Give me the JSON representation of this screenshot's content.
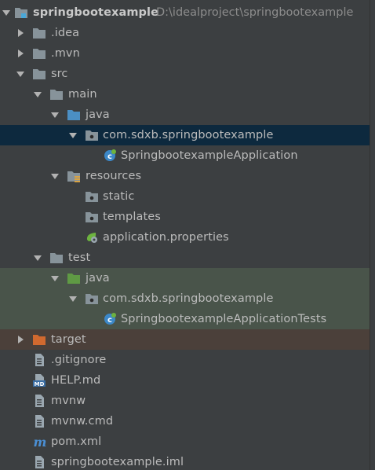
{
  "project_tree": {
    "root": {
      "name": "springbootexample",
      "path": "D:\\idealproject\\springbootexample"
    },
    "nodes": [
      {
        "label": ".idea",
        "icon": "folder-icon"
      },
      {
        "label": ".mvn",
        "icon": "folder-icon"
      },
      {
        "label": "src",
        "icon": "folder-icon"
      },
      {
        "label": "main",
        "icon": "folder-icon"
      },
      {
        "label": "java",
        "icon": "source-root-folder-icon"
      },
      {
        "label": "com.sdxb.springbootexample",
        "icon": "package-icon"
      },
      {
        "label": "SpringbootexampleApplication",
        "icon": "spring-boot-class-icon"
      },
      {
        "label": "resources",
        "icon": "resources-folder-icon"
      },
      {
        "label": "static",
        "icon": "package-icon"
      },
      {
        "label": "templates",
        "icon": "package-icon"
      },
      {
        "label": "application.properties",
        "icon": "spring-properties-icon"
      },
      {
        "label": "test",
        "icon": "folder-icon"
      },
      {
        "label": "java",
        "icon": "test-root-folder-icon"
      },
      {
        "label": "com.sdxb.springbootexample",
        "icon": "package-icon"
      },
      {
        "label": "SpringbootexampleApplicationTests",
        "icon": "spring-boot-class-icon"
      },
      {
        "label": "target",
        "icon": "excluded-folder-icon"
      },
      {
        "label": ".gitignore",
        "icon": "text-file-icon"
      },
      {
        "label": "HELP.md",
        "icon": "markdown-file-icon"
      },
      {
        "label": "mvnw",
        "icon": "text-file-icon"
      },
      {
        "label": "mvnw.cmd",
        "icon": "text-file-icon"
      },
      {
        "label": "pom.xml",
        "icon": "maven-icon"
      },
      {
        "label": "springbootexample.iml",
        "icon": "iml-file-icon"
      }
    ]
  },
  "colors": {
    "background": "#3c3f41",
    "selection": "#0d293e",
    "test_sources": "#49544a",
    "excluded": "#4b403a",
    "folder": "#87939a",
    "source_root": "#4b8fc4",
    "test_root": "#5f9a44",
    "excluded_folder": "#d1692f"
  }
}
